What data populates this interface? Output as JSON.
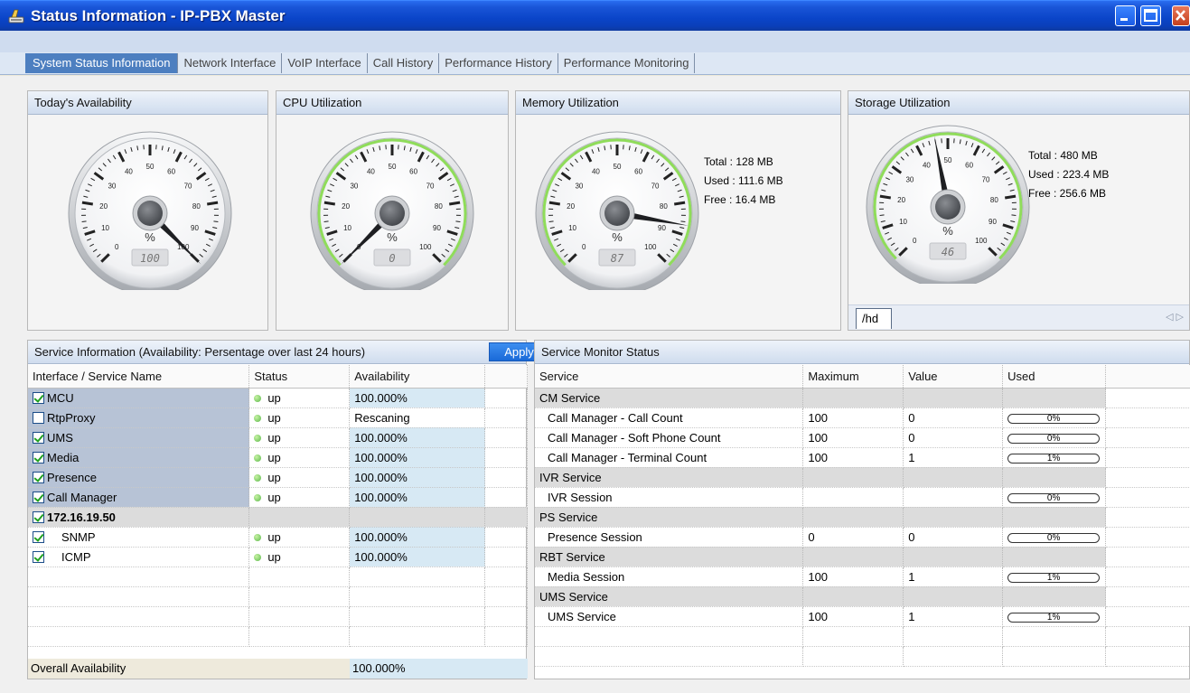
{
  "window": {
    "title": "Status Information - IP-PBX Master"
  },
  "tabs": [
    {
      "label": "System Status Information",
      "active": true
    },
    {
      "label": "Network Interface",
      "active": false
    },
    {
      "label": "VoIP Interface",
      "active": false
    },
    {
      "label": "Call History",
      "active": false
    },
    {
      "label": "Performance History",
      "active": false
    },
    {
      "label": "Performance Monitoring",
      "active": false
    }
  ],
  "gauges": {
    "availability": {
      "title": "Today's Availability",
      "value": 100,
      "readout": "100",
      "unit": "%"
    },
    "cpu": {
      "title": "CPU Utilization",
      "value": 0,
      "readout": "0",
      "unit": "%"
    },
    "memory": {
      "title": "Memory Utilization",
      "value": 87,
      "readout": "87",
      "unit": "%",
      "total": "Total : 128 MB",
      "used": "Used : 111.6 MB",
      "free": "Free : 16.4 MB"
    },
    "storage": {
      "title": "Storage Utilization",
      "value": 46,
      "readout": "46",
      "unit": "%",
      "total": "Total : 480 MB",
      "used": "Used : 223.4 MB",
      "free": "Free : 256.6 MB",
      "tab_label": "/hd",
      "scroll_arrows": "◁ ▷"
    }
  },
  "gauge_ticks": [
    "0",
    "10",
    "20",
    "30",
    "40",
    "50",
    "60",
    "70",
    "80",
    "90",
    "100"
  ],
  "service_info": {
    "title": "Service Information (Availability: Persentage over last 24 hours)",
    "apply_label": "Apply",
    "columns": [
      "Interface / Service Name",
      "Status",
      "Availability"
    ],
    "rows": [
      {
        "name": "MCU",
        "checked": true,
        "status": "up",
        "availability": "100.000%",
        "group": false,
        "indent": false
      },
      {
        "name": "RtpProxy",
        "checked": false,
        "status": "up",
        "availability": "Rescaning",
        "group": false,
        "indent": false
      },
      {
        "name": "UMS",
        "checked": true,
        "status": "up",
        "availability": "100.000%",
        "group": false,
        "indent": false
      },
      {
        "name": "Media",
        "checked": true,
        "status": "up",
        "availability": "100.000%",
        "group": false,
        "indent": false
      },
      {
        "name": "Presence",
        "checked": true,
        "status": "up",
        "availability": "100.000%",
        "group": false,
        "indent": false
      },
      {
        "name": "Call Manager",
        "checked": true,
        "status": "up",
        "availability": "100.000%",
        "group": false,
        "indent": false
      },
      {
        "name": "172.16.19.50",
        "checked": true,
        "status": "",
        "availability": "",
        "group": true,
        "indent": false
      },
      {
        "name": "SNMP",
        "checked": true,
        "status": "up",
        "availability": "100.000%",
        "group": false,
        "indent": true
      },
      {
        "name": "ICMP",
        "checked": true,
        "status": "up",
        "availability": "100.000%",
        "group": false,
        "indent": true
      }
    ],
    "overall_label": "Overall Availability",
    "overall_value": "100.000%"
  },
  "service_monitor": {
    "title": "Service Monitor Status",
    "columns": [
      "Service",
      "Maximum",
      "Value",
      "Used"
    ],
    "rows": [
      {
        "service": "CM Service",
        "group": true
      },
      {
        "service": "Call Manager - Call Count",
        "maximum": "100",
        "value": "0",
        "used": "0%"
      },
      {
        "service": "Call Manager - Soft Phone Count",
        "maximum": "100",
        "value": "0",
        "used": "0%"
      },
      {
        "service": "Call Manager - Terminal Count",
        "maximum": "100",
        "value": "1",
        "used": "1%"
      },
      {
        "service": "IVR Service",
        "group": true
      },
      {
        "service": "IVR Session",
        "maximum": "",
        "value": "",
        "used": "0%"
      },
      {
        "service": "PS Service",
        "group": true
      },
      {
        "service": "Presence Session",
        "maximum": "0",
        "value": "0",
        "used": "0%"
      },
      {
        "service": "RBT Service",
        "group": true
      },
      {
        "service": "Media Session",
        "maximum": "100",
        "value": "1",
        "used": "1%"
      },
      {
        "service": "UMS Service",
        "group": true
      },
      {
        "service": "UMS Service",
        "maximum": "100",
        "value": "1",
        "used": "1%"
      }
    ]
  },
  "colors": {
    "titlebar": "#0a44c8",
    "active_tab": "#4d7fc0",
    "status_up": "#5bb94a",
    "gauge_ring": "#8fdc5a",
    "apply_button": "#1a6ad8"
  }
}
